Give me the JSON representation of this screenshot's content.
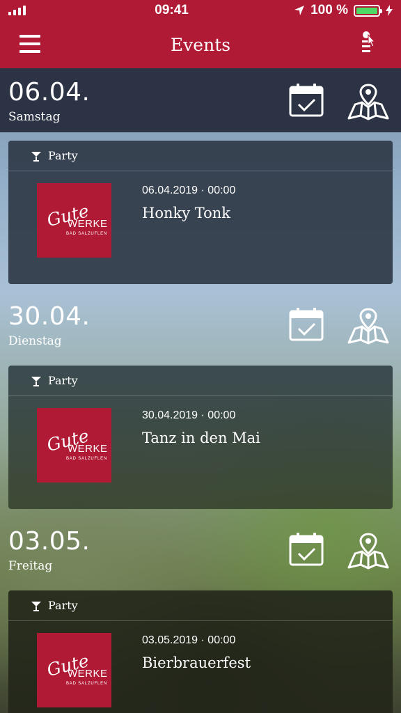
{
  "status_bar": {
    "time": "09:41",
    "battery": "100 %",
    "battery_level": 1.0
  },
  "nav": {
    "title": "Events",
    "menu_icon": "hamburger-menu-icon",
    "settings_icon": "filter-settings-icon"
  },
  "days": [
    {
      "date": "06.04.",
      "weekday": "Samstag",
      "event": {
        "category": "Party",
        "datetime": "06.04.2019 · 00:00",
        "title": "Honky Tonk",
        "logo": {
          "script": "Gute",
          "word": "WERKE",
          "sub": "BAD SALZUFLEN"
        }
      }
    },
    {
      "date": "30.04.",
      "weekday": "Dienstag",
      "event": {
        "category": "Party",
        "datetime": "30.04.2019 · 00:00",
        "title": "Tanz in den Mai",
        "logo": {
          "script": "Gute",
          "word": "WERKE",
          "sub": "BAD SALZUFLEN"
        }
      }
    },
    {
      "date": "03.05.",
      "weekday": "Freitag",
      "event": {
        "category": "Party",
        "datetime": "03.05.2019 · 00:00",
        "title": "Bierbrauerfest",
        "logo": {
          "script": "Gute",
          "word": "WERKE",
          "sub": "BAD SALZUFLEN"
        }
      }
    }
  ],
  "colors": {
    "brand": "#b11a35",
    "header_dark": "#2b3344",
    "battery_green": "#4cd964"
  }
}
